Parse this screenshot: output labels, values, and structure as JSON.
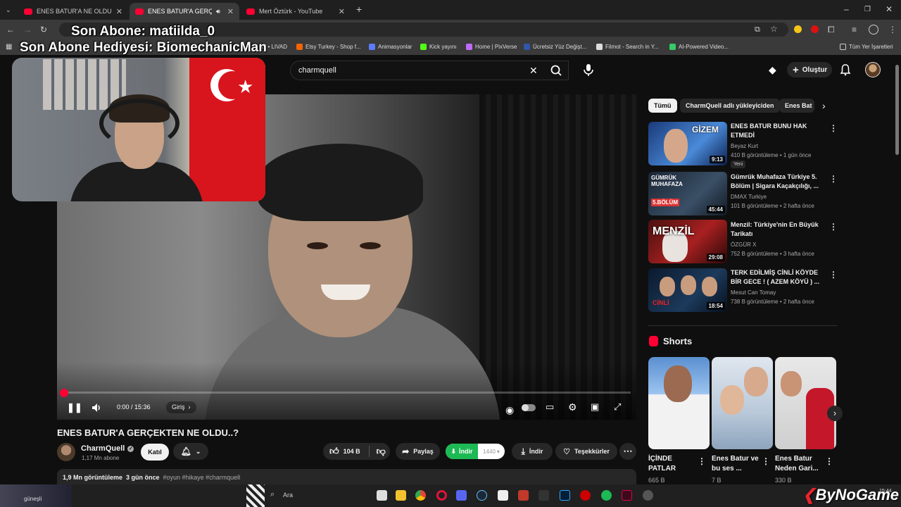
{
  "tabs": [
    {
      "title": "ENES BATUR'A NE OLDUĞUNU",
      "active": false
    },
    {
      "title": "ENES BATUR'A GERÇEKTEN",
      "active": true
    },
    {
      "title": "Mert Öztürk - YouTube",
      "active": false
    }
  ],
  "overlay": {
    "line1": "Son Abone: matiilda_0",
    "line2": "Son Abone Hediyesi: BiomechanicMan"
  },
  "bookmarks": [
    {
      "label": "Etsy Turkey - Shop f...",
      "color": "#f56400"
    },
    {
      "label": "Animasyonlar",
      "color": "#5b7cff"
    },
    {
      "label": "Kick yayını",
      "color": "#53fc18"
    },
    {
      "label": "Home | PixVerse",
      "color": "#c06bff"
    },
    {
      "label": "Ücretsiz Yüz Değişt...",
      "color": "#3355aa"
    },
    {
      "label": "Filmot - Search in Y...",
      "color": "#dddddd"
    },
    {
      "label": "AI-Powered Video...",
      "color": "#33cc66"
    }
  ],
  "bookmark_partial": "ol • LIVAD",
  "all_bookmarks": "Tüm Yer İşaretleri",
  "search": {
    "value": "charmquell"
  },
  "header": {
    "create_label": "Oluştur"
  },
  "player": {
    "time": "0:00 / 15:36",
    "chapter": "Giriş",
    "progress": 0
  },
  "video": {
    "title": "ENES BATUR'A GERÇEKTEN NE OLDU..?",
    "channel": "CharmQuell",
    "subscribers": "1,17 Mn abone",
    "join_label": "Katıl",
    "likes": "104 B",
    "share_label": "Paylaş",
    "download_ext_label": "İndir",
    "download_ext_quality": "1440",
    "download_label": "İndir",
    "thanks_label": "Teşekkürler",
    "views": "1,9 Mn görüntüleme",
    "date": "3 gün önce",
    "tags": "#oyun #hikaye #charmquell"
  },
  "chips": [
    "Tümü",
    "CharmQuell adlı yükleyiciden",
    "Enes Bat"
  ],
  "recommendations": [
    {
      "title": "ENES BATUR BUNU HAK ETMEDİ",
      "channel": "Beyaz Kurt",
      "stats": "410 B görüntüleme • 1 gün önce",
      "badge": "Yeni",
      "duration": "9:13"
    },
    {
      "title": "Gümrük Muhafaza Türkiye 5. Bölüm | Sigara Kaçakçılığı, ...",
      "channel": "DMAX Turkiye",
      "stats": "101 B görüntüleme • 2 hafta önce",
      "duration": "45:44"
    },
    {
      "title": "Menzil: Türkiye'nin En Büyük Tarikatı",
      "channel": "ÖZGÜR X",
      "stats": "752 B görüntüleme • 3 hafta önce",
      "duration": "29:08"
    },
    {
      "title": "TERK EDİLMİŞ CİNLİ KÖYDE BİR GECE ! ( AZEM KÖYÜ ) ...",
      "channel": "Mesut Can Tomay",
      "stats": "738 B görüntüleme • 2 hafta önce",
      "duration": "18:54"
    }
  ],
  "shorts_heading": "Shorts",
  "shorts": [
    {
      "title": "İÇİNDE PATLAR",
      "views": "665 B"
    },
    {
      "title": "Enes Batur ve bu ses ...",
      "views": "7 B"
    },
    {
      "title": "Enes Batur Neden Gari...",
      "views": "330 B"
    }
  ],
  "taskbar": {
    "search": "Ara",
    "clock": "15:44",
    "weather": "güneşli"
  },
  "watermark": "ByNoGame"
}
